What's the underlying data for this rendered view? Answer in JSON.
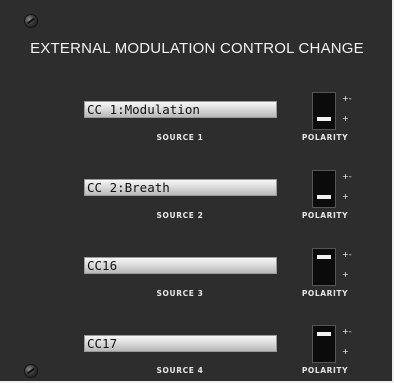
{
  "title": "EXTERNAL MODULATION CONTROL CHANGE",
  "polarity_label": "POLARITY",
  "polarity_symbols": {
    "up": "+-",
    "down": "+"
  },
  "sources": [
    {
      "value": "CC 1:Modulation",
      "label": "SOURCE 1",
      "polarity": "down"
    },
    {
      "value": "CC 2:Breath",
      "label": "SOURCE 2",
      "polarity": "down"
    },
    {
      "value": "CC16",
      "label": "SOURCE 3",
      "polarity": "up"
    },
    {
      "value": "CC17",
      "label": "SOURCE 4",
      "polarity": "up"
    }
  ]
}
